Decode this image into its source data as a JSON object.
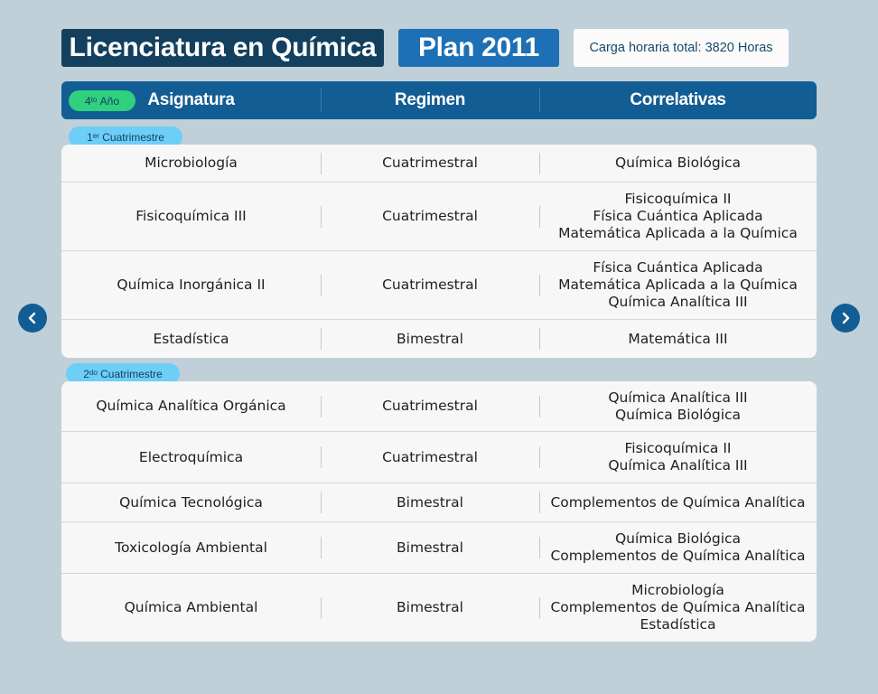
{
  "header": {
    "title": "Licenciatura en Química",
    "plan": "Plan 2011",
    "hours": "Carga horaria total: 3820 Horas"
  },
  "table_header": {
    "year_num": "4",
    "year_sup": "to",
    "year_word": "Año",
    "col_subject": "Asignatura",
    "col_regime": "Regimen",
    "col_prereq": "Correlativas"
  },
  "terms": [
    {
      "num": "1",
      "sup": "er",
      "label": "Cuatrimestre",
      "rows": [
        {
          "subject": "Microbiología",
          "regime": "Cuatrimestral",
          "prereqs": [
            "Química Biológica"
          ]
        },
        {
          "subject": "Fisicoquímica III",
          "regime": "Cuatrimestral",
          "prereqs": [
            "Fisicoquímica II",
            "Física Cuántica Aplicada",
            "Matemática Aplicada a la Química"
          ]
        },
        {
          "subject": "Química Inorgánica II",
          "regime": "Cuatrimestral",
          "prereqs": [
            "Física Cuántica Aplicada",
            "Matemática Aplicada a la Química",
            "Química Analítica III"
          ]
        },
        {
          "subject": "Estadística",
          "regime": "Bimestral",
          "prereqs": [
            "Matemática III"
          ]
        }
      ]
    },
    {
      "num": "2",
      "sup": "do",
      "label": "Cuatrimestre",
      "rows": [
        {
          "subject": "Química Analítica Orgánica",
          "regime": "Cuatrimestral",
          "prereqs": [
            "Química Analítica III",
            "Química Biológica"
          ]
        },
        {
          "subject": "Electroquímica",
          "regime": "Cuatrimestral",
          "prereqs": [
            "Fisicoquímica II",
            "Química Analítica III"
          ]
        },
        {
          "subject": "Química Tecnológica",
          "regime": "Bimestral",
          "prereqs": [
            "Complementos de Química Analítica"
          ]
        },
        {
          "subject": "Toxicología Ambiental",
          "regime": "Bimestral",
          "prereqs": [
            "Química Biológica",
            "Complementos de Química Analítica"
          ]
        },
        {
          "subject": "Química Ambiental",
          "regime": "Bimestral",
          "prereqs": [
            "Microbiología",
            "Complementos de Química Analítica",
            "Estadística"
          ]
        }
      ]
    }
  ],
  "nav": {
    "prev_icon": "chevron-left-icon",
    "next_icon": "chevron-right-icon"
  },
  "colors": {
    "background": "#bfd0d8",
    "title_bg": "#12405e",
    "plan_bg": "#1d70b5",
    "header_bg": "#135d95",
    "year_pill": "#2fd17e",
    "term_pill": "#6dcef7"
  }
}
